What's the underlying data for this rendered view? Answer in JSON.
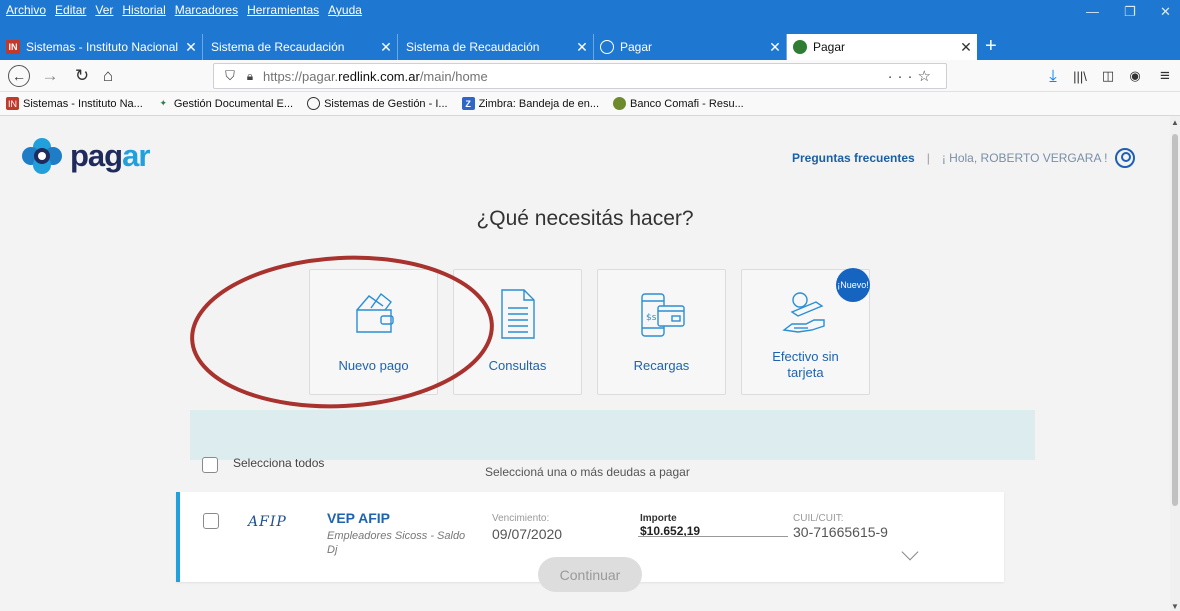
{
  "browser": {
    "menu": [
      "Archivo",
      "Editar",
      "Ver",
      "Historial",
      "Marcadores",
      "Herramientas",
      "Ayuda"
    ],
    "tabs": [
      {
        "label": "Sistemas - Instituto Nacional de",
        "icon": "inaes-icon"
      },
      {
        "label": "Sistema de Recaudación",
        "icon": ""
      },
      {
        "label": "Sistema de Recaudación",
        "icon": ""
      },
      {
        "label": "Pagar",
        "icon": "globe-icon"
      },
      {
        "label": "Pagar",
        "icon": "pagar-favicon",
        "active": true
      }
    ],
    "url": {
      "prefix": "https://pagar.",
      "host": "redlink.com.ar",
      "path": "/main/home"
    },
    "bookmarks": [
      "Sistemas - Instituto Na...",
      "Gestión Documental E...",
      "Sistemas de Gestión - I...",
      "Zimbra: Bandeja de en...",
      "Banco Comafi - Resu..."
    ]
  },
  "header": {
    "faq_label": "Preguntas frecuentes",
    "separator": "|",
    "greeting": "¡ Hola, ROBERTO VERGARA !"
  },
  "main": {
    "question": "¿Qué necesitás hacer?",
    "cards": [
      {
        "label": "Nuevo pago"
      },
      {
        "label": "Consultas"
      },
      {
        "label": "Recargas"
      },
      {
        "label": "Efectivo sin tarjeta",
        "badge": "¡Nuevo!"
      }
    ],
    "select_all": "Selecciona todos",
    "hint": "Seleccioná una o más deudas a pagar",
    "debt": {
      "logo": "AFIP",
      "title": "VEP AFIP",
      "subtitle": "Empleadores Sicoss - Saldo Dj",
      "due_caption": "Vencimiento:",
      "due_value": "09/07/2020",
      "amount_caption": "Importe",
      "amount_value": "$10.652,19",
      "cuit_caption": "CUIL/CUIT:",
      "cuit_value": "30-71665615-9"
    },
    "continue_label": "Continuar"
  },
  "colors": {
    "chrome_blue": "#1e78d2",
    "brand_dark": "#1f2b5c",
    "brand_light": "#21a0dc",
    "link_blue": "#1d63b0",
    "annotation_red": "#a8322d"
  }
}
